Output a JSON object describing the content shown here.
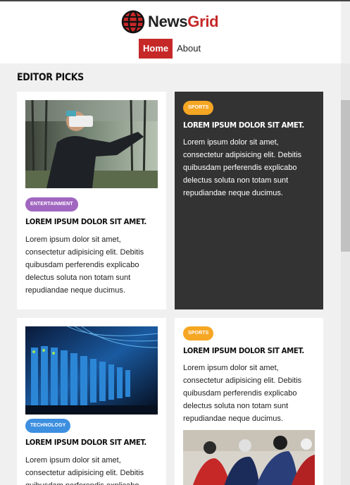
{
  "brand": {
    "name_main": "News",
    "name_accent": "Grid",
    "logo_icon": "globe-icon"
  },
  "nav": {
    "items": [
      {
        "label": "Home",
        "active": true
      },
      {
        "label": "About",
        "active": false
      }
    ]
  },
  "section": {
    "title": "EDITOR PICKS"
  },
  "cards": [
    {
      "category": "ENTERTAINMENT",
      "category_color": "#a066c0",
      "title": "LOREM IPSUM DOLOR SIT AMET.",
      "excerpt": "Lorem ipsum dolor sit amet, consectetur adipisicing elit. Debitis quibusdam perferendis explicabo delectus soluta non totam sunt repudiandae neque ducimus.",
      "image": "vr-headset-forest"
    },
    {
      "category": "SPORTS",
      "category_color": "#f5a623",
      "title": "LOREM IPSUM DOLOR SIT AMET.",
      "excerpt": "Lorem ipsum dolor sit amet, consectetur adipisicing elit. Debitis quibusdam perferendis explicabo delectus soluta non totam sunt repudiandae neque ducimus."
    },
    {
      "category": "TECHNOLOGY",
      "category_color": "#3d8fe0",
      "title": "LOREM IPSUM DOLOR SIT AMET.",
      "excerpt": "Lorem ipsum dolor sit amet, consectetur adipisicing elit. Debitis quibusdam perferendis explicabo",
      "image": "server-rack"
    },
    {
      "category": "SPORTS",
      "category_color": "#f5a623",
      "title": "LOREM IPSUM DOLOR SIT AMET.",
      "excerpt": "Lorem ipsum dolor sit amet, consectetur adipisicing elit. Debitis quibusdam perferendis explicabo delectus soluta non totam sunt repudiandae neque ducimus.",
      "image": "cyclists-race"
    }
  ],
  "colors": {
    "brand_red": "#c62828",
    "dark_card": "#333333",
    "page_bg": "#f0f0f0"
  }
}
